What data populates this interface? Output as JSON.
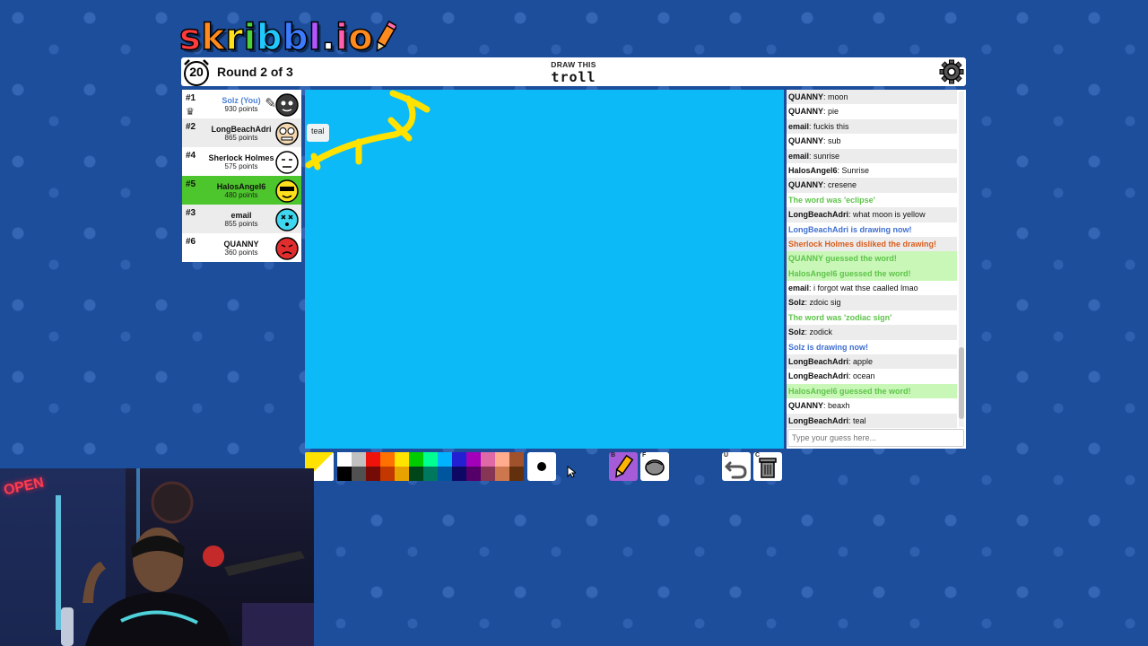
{
  "logo": {
    "text": "skribbl.io",
    "letters": [
      "s",
      "k",
      "r",
      "i",
      "b",
      "b",
      "l",
      ".",
      "i",
      "o"
    ],
    "colors": [
      "#ff3b3b",
      "#ff8a1d",
      "#ffe11d",
      "#4cd13a",
      "#21c8ff",
      "#3c7bff",
      "#b155ff",
      "#ffffff",
      "#ff5fae",
      "#ff8a1d"
    ]
  },
  "header": {
    "timer": "20",
    "round_label": "Round 2 of 3",
    "draw_this_label": "DRAW THIS",
    "word": "troll"
  },
  "players": [
    {
      "rank": "#1",
      "name": "Solz (You)",
      "points": "930 points",
      "is_me": true,
      "crown": true,
      "drawing": true,
      "avatar_color": "#3a3a3a"
    },
    {
      "rank": "#2",
      "name": "LongBeachAdri",
      "points": "865 points",
      "is_me": false,
      "crown": false,
      "drawing": false,
      "avatar_color": "#f2d7b0"
    },
    {
      "rank": "#4",
      "name": "Sherlock Holmes",
      "points": "575 points",
      "is_me": false,
      "crown": false,
      "drawing": false,
      "avatar_color": "#ffffff"
    },
    {
      "rank": "#5",
      "name": "HalosAngel6",
      "points": "480 points",
      "is_me": false,
      "crown": false,
      "drawing": false,
      "guessed": true,
      "avatar_color": "#ffe01d"
    },
    {
      "rank": "#3",
      "name": "email",
      "points": "855 points",
      "is_me": false,
      "crown": false,
      "drawing": false,
      "avatar_color": "#3fd6f0"
    },
    {
      "rank": "#6",
      "name": "QUANNY",
      "points": "360 points",
      "is_me": false,
      "crown": false,
      "drawing": false,
      "avatar_color": "#e12d2d"
    }
  ],
  "canvas": {
    "background": "#0cbaf8",
    "stroke_color": "#ffe200"
  },
  "guess_bubble": "teal",
  "chat": {
    "messages": [
      {
        "user": "QUANNY",
        "text": "moon",
        "type": "normal"
      },
      {
        "user": "QUANNY",
        "text": "pie",
        "type": "normal"
      },
      {
        "user": "email",
        "text": "fuckis this",
        "type": "normal"
      },
      {
        "user": "QUANNY",
        "text": "sub",
        "type": "normal"
      },
      {
        "user": "email",
        "text": "sunrise",
        "type": "normal"
      },
      {
        "user": "HalosAngel6",
        "text": "Sunrise",
        "type": "normal"
      },
      {
        "user": "QUANNY",
        "text": "cresene",
        "type": "normal"
      },
      {
        "user": "",
        "text": "The word was 'eclipse'",
        "type": "green"
      },
      {
        "user": "LongBeachAdri",
        "text": "what moon is yellow",
        "type": "normal"
      },
      {
        "user": "",
        "text": "LongBeachAdri is drawing now!",
        "type": "blue"
      },
      {
        "user": "",
        "text": "Sherlock Holmes disliked the drawing!",
        "type": "red"
      },
      {
        "user": "",
        "text": "QUANNY guessed the word!",
        "type": "greenbg"
      },
      {
        "user": "",
        "text": "HalosAngel6 guessed the word!",
        "type": "greenbg"
      },
      {
        "user": "email",
        "text": "i forgot wat thse caalled lmao",
        "type": "normal"
      },
      {
        "user": "Solz",
        "text": "zdoic sig",
        "type": "normal"
      },
      {
        "user": "",
        "text": "The word was 'zodiac sign'",
        "type": "green"
      },
      {
        "user": "Solz",
        "text": "zodick",
        "type": "normal"
      },
      {
        "user": "",
        "text": "Solz is drawing now!",
        "type": "blue"
      },
      {
        "user": "LongBeachAdri",
        "text": "apple",
        "type": "normal"
      },
      {
        "user": "LongBeachAdri",
        "text": "ocean",
        "type": "normal"
      },
      {
        "user": "",
        "text": "HalosAngel6 guessed the word!",
        "type": "greenbg"
      },
      {
        "user": "QUANNY",
        "text": "beaxh",
        "type": "normal"
      },
      {
        "user": "LongBeachAdri",
        "text": "teal",
        "type": "normal"
      }
    ],
    "input_placeholder": "Type your guess here..."
  },
  "toolbar": {
    "current_color": "#ffe200",
    "palette_top": [
      "#ffffff",
      "#c1c1c1",
      "#ef130b",
      "#ff7100",
      "#ffe400",
      "#00cc00",
      "#00ff91",
      "#00b2ff",
      "#231fd3",
      "#a300ba",
      "#df69a7",
      "#ffac8e",
      "#a0522d"
    ],
    "palette_bottom": [
      "#000000",
      "#505050",
      "#740b07",
      "#c23800",
      "#e8a200",
      "#004619",
      "#00785d",
      "#00569e",
      "#0e0865",
      "#550069",
      "#873554",
      "#cc774d",
      "#63300d"
    ],
    "tool_keys": {
      "pencil": "B",
      "fill": "F",
      "undo": "U",
      "clear": "C"
    }
  },
  "webcam": {
    "sign_text": "OPEN"
  }
}
